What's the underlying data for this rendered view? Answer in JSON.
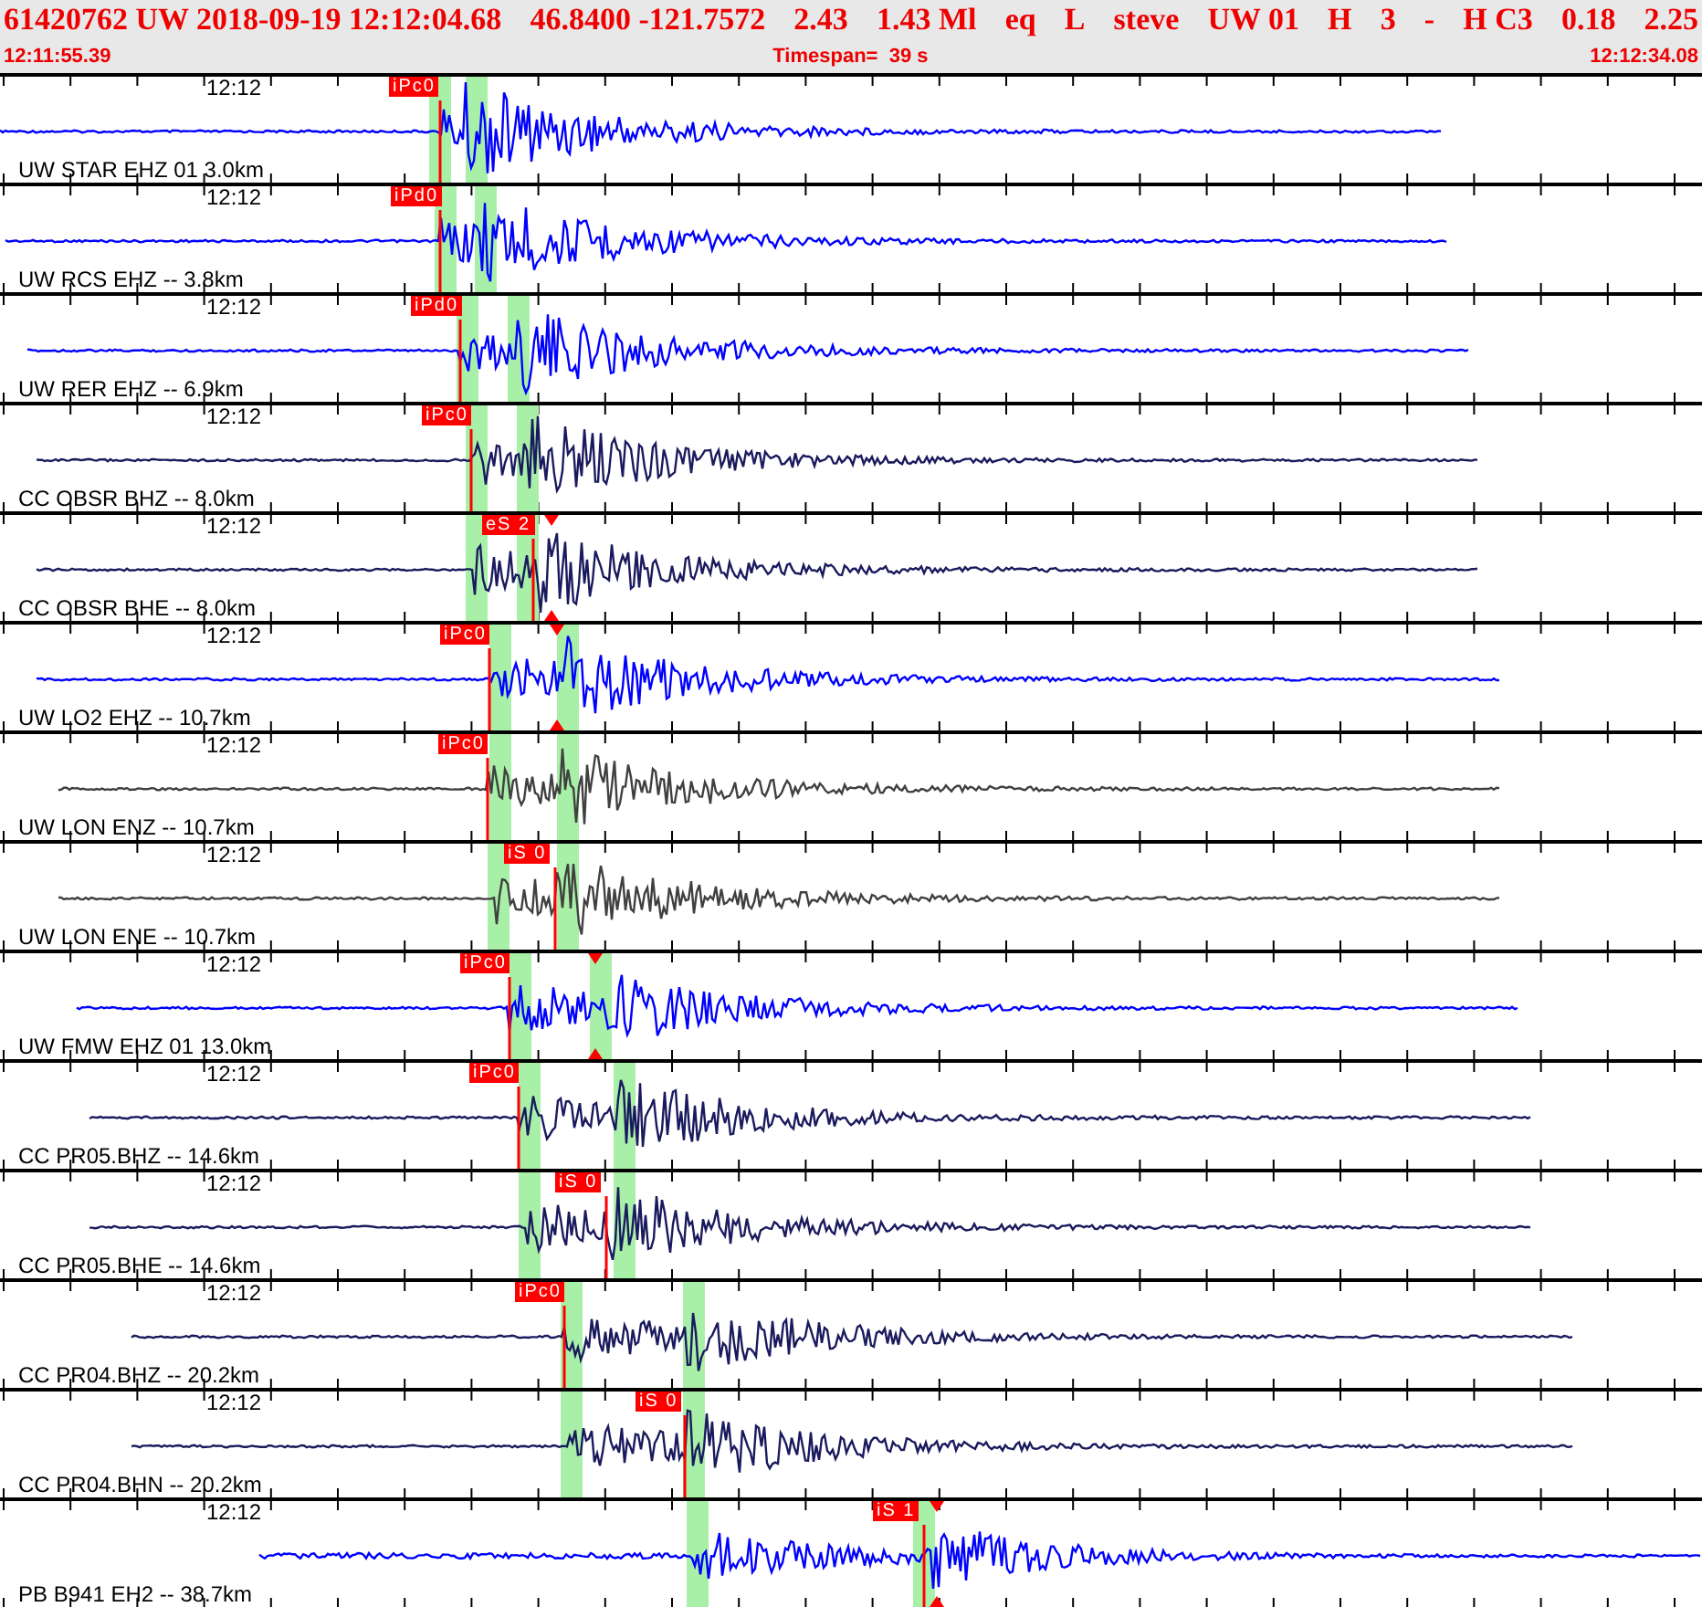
{
  "header": {
    "segments": [
      "61420762 UW 2018-09-19 12:12:04.68",
      "46.8400 -121.7572",
      "2.43",
      "1.43 Ml",
      "eq",
      "L",
      "steve",
      "UW 01",
      "H",
      "3",
      "-",
      "H C3",
      "0.18",
      "2.25"
    ]
  },
  "subheader": {
    "start": "12:11:55.39",
    "timespan": "Timespan=  39 s",
    "end": "12:12:34.08"
  },
  "traces": [
    {
      "time_label": "12:12",
      "station": "UW STAR EHZ 01 3.0km",
      "color": "#0000ff",
      "pick": "iPc0"
    },
    {
      "time_label": "12:12",
      "station": "UW RCS EHZ -- 3.8km",
      "color": "#0000ff",
      "pick": "iPd0"
    },
    {
      "time_label": "12:12",
      "station": "UW RER EHZ -- 6.9km",
      "color": "#0000ff",
      "pick": "iPd0"
    },
    {
      "time_label": "12:12",
      "station": "CC OBSR BHZ -- 8.0km",
      "color": "#1a1a5e",
      "pick": "iPc0"
    },
    {
      "time_label": "12:12",
      "station": "CC OBSR BHE -- 8.0km",
      "color": "#1a1a5e",
      "pick": "eS 2"
    },
    {
      "time_label": "12:12",
      "station": "UW LO2 EHZ -- 10.7km",
      "color": "#0000ff",
      "pick": "iPc0"
    },
    {
      "time_label": "12:12",
      "station": "UW LON ENZ -- 10.7km",
      "color": "#404040",
      "pick": "iPc0"
    },
    {
      "time_label": "12:12",
      "station": "UW LON ENE -- 10.7km",
      "color": "#404040",
      "pick": "iS 0"
    },
    {
      "time_label": "12:12",
      "station": "UW FMW EHZ 01 13.0km",
      "color": "#0000ff",
      "pick": "iPc0"
    },
    {
      "time_label": "12:12",
      "station": "CC PR05.BHZ -- 14.6km",
      "color": "#1a1a5e",
      "pick": "iPc0"
    },
    {
      "time_label": "12:12",
      "station": "CC PR05.BHE -- 14.6km",
      "color": "#1a1a5e",
      "pick": "iS 0"
    },
    {
      "time_label": "12:12",
      "station": "CC PR04.BHZ -- 20.2km",
      "color": "#1a1a5e",
      "pick": "iPc0"
    },
    {
      "time_label": "12:12",
      "station": "CC PR04.BHN -- 20.2km",
      "color": "#1a1a5e",
      "pick": "iS 0"
    },
    {
      "time_label": "12:12",
      "station": "PB B941 EH2 -- 38.7km",
      "color": "#0000ff",
      "pick": "iS 1"
    }
  ]
}
